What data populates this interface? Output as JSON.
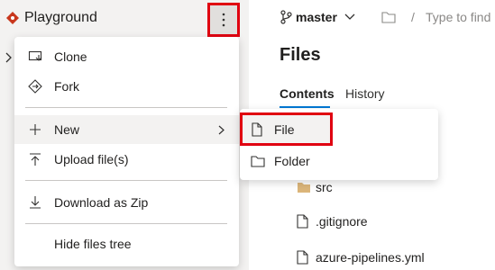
{
  "repo": {
    "name": "Playground"
  },
  "branch": {
    "name": "master",
    "search_hint": "Type to find"
  },
  "breadcrumb": {
    "separator": "/"
  },
  "files": {
    "title": "Files",
    "tabs": [
      {
        "label": "Contents"
      },
      {
        "label": "History"
      }
    ],
    "rows": [
      {
        "name": "src",
        "kind": "folder"
      },
      {
        "name": ".gitignore",
        "kind": "file"
      },
      {
        "name": "azure-pipelines.yml",
        "kind": "file"
      }
    ]
  },
  "menu": {
    "items": [
      {
        "label": "Clone",
        "icon": "clone-icon"
      },
      {
        "label": "Fork",
        "icon": "fork-icon"
      },
      {
        "label": "New",
        "icon": "plus-icon",
        "has_submenu": true
      },
      {
        "label": "Upload file(s)",
        "icon": "upload-icon"
      },
      {
        "label": "Download as Zip",
        "icon": "download-icon"
      },
      {
        "label": "Hide files tree",
        "icon": ""
      }
    ]
  },
  "submenu": {
    "items": [
      {
        "label": "File",
        "icon": "file-icon"
      },
      {
        "label": "Folder",
        "icon": "folder-icon"
      }
    ]
  },
  "colors": {
    "highlight_border": "#e00010",
    "accent": "#0078d4",
    "repo_icon": "#c8371d",
    "folder": "#dcb67a"
  }
}
